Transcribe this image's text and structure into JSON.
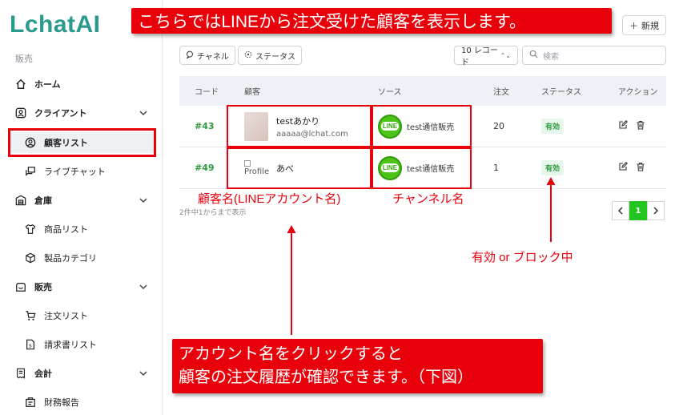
{
  "sidebar": {
    "logo": "LchatAI",
    "section": "販売",
    "items": [
      {
        "label": "ホーム"
      },
      {
        "label": "クライアント"
      },
      {
        "label": "顧客リスト"
      },
      {
        "label": "ライブチャット"
      },
      {
        "label": "倉庫"
      },
      {
        "label": "商品リスト"
      },
      {
        "label": "製品カテゴリ"
      },
      {
        "label": "販売"
      },
      {
        "label": "注文リスト"
      },
      {
        "label": "請求書リスト"
      },
      {
        "label": "会計"
      },
      {
        "label": "財務報告"
      }
    ]
  },
  "header": {
    "new_button": "新規"
  },
  "filters": {
    "channel": "チャネル",
    "status": "ステータス",
    "per_page": "10 レコード",
    "search_placeholder": "検索"
  },
  "table": {
    "columns": [
      "コード",
      "顧客",
      "ソース",
      "注文",
      "ステータス",
      "アクション"
    ],
    "rows": [
      {
        "code": "#43",
        "name": "testあかり",
        "email": "aaaaa@lchat.com",
        "source_logo": "LINE",
        "source": "test通信販売",
        "orders": "20",
        "status": "有効"
      },
      {
        "code": "#49",
        "image_alt": "Profile",
        "name": "あべ",
        "source_logo": "LINE",
        "source": "test通信販売",
        "orders": "1",
        "status": "有効"
      }
    ],
    "footnote": "2件中1からまで表示"
  },
  "pagination": {
    "current": "1"
  },
  "annotations": {
    "top_banner": "こちらではLINEから注文受けた顧客を表示します。",
    "customer_label": "顧客名(LINEアカウント名)",
    "channel_label": "チャンネル名",
    "status_label": "有効 or ブロック中",
    "bottom_line1": "アカウント名をクリックすると",
    "bottom_line2": "顧客の注文履歴が確認できます。（下図）"
  },
  "colors": {
    "accent_red": "#e8000b",
    "brand_teal": "#2b9a8c",
    "line_green": "#4cc417",
    "active_green": "#2e9a3d"
  }
}
